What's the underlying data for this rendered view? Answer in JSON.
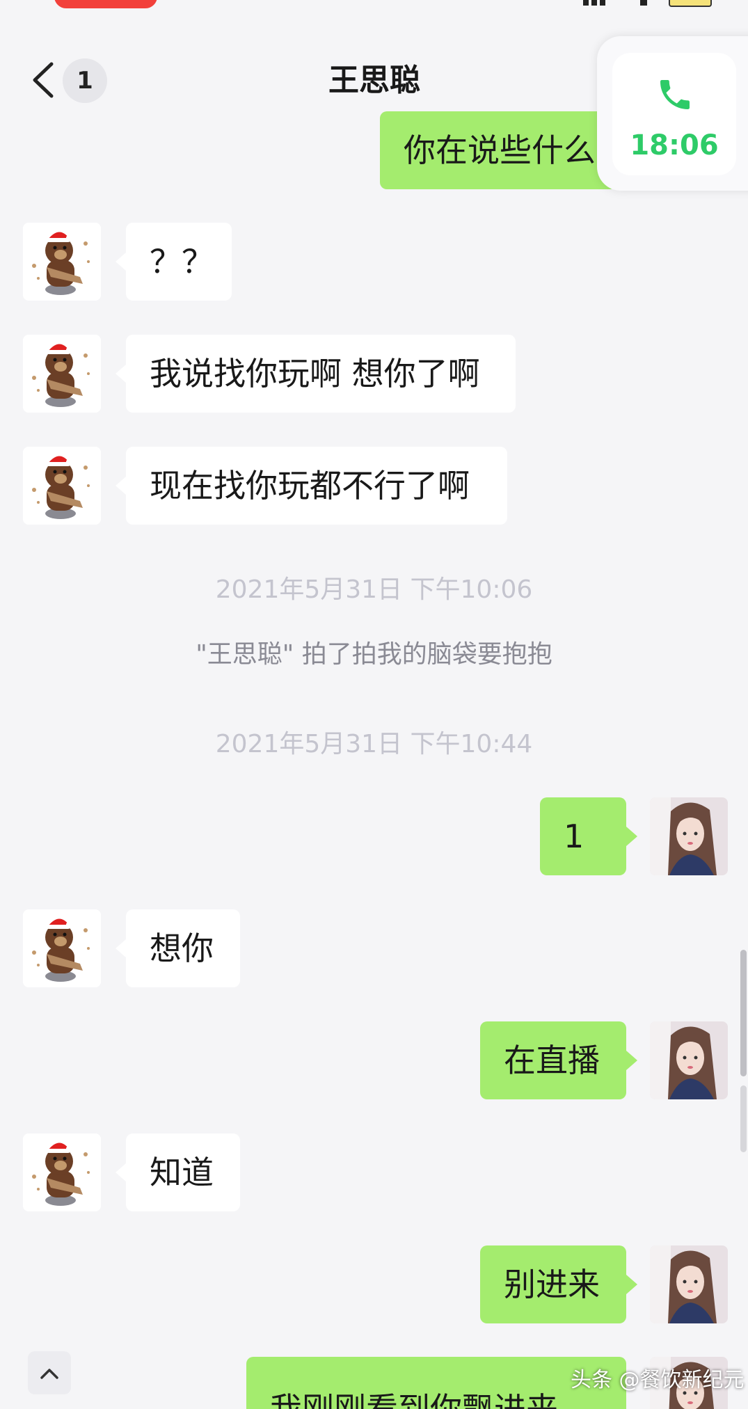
{
  "header": {
    "title": "王思聪",
    "unread_badge": "1"
  },
  "call_card": {
    "icon": "phone-icon",
    "duration": "18:06"
  },
  "messages": [
    {
      "side": "right",
      "text": "你在说些什么"
    },
    {
      "side": "left",
      "text": "？？"
    },
    {
      "side": "left",
      "text": "我说找你玩啊 想你了啊"
    },
    {
      "side": "left",
      "text": "现在找你玩都不行了啊"
    },
    {
      "side": "left",
      "text": "想你"
    },
    {
      "side": "right",
      "text": "1"
    },
    {
      "side": "right",
      "text": "在直播"
    },
    {
      "side": "left",
      "text": "知道"
    },
    {
      "side": "right",
      "text": "别进来"
    },
    {
      "side": "right",
      "text": "我刚刚看到你飘进来"
    }
  ],
  "timestamps": [
    "2021年5月31日 下午10:06",
    "2021年5月31日 下午10:44"
  ],
  "system_notice": "\"王思聪\" 拍了拍我的脑袋要抱抱",
  "watermark": "头条 @餐饮新纪元",
  "colors": {
    "sent_bubble": "#a4ec6e",
    "received_bubble": "#ffffff",
    "call_accent": "#2ecb68",
    "background": "#f5f5f7"
  }
}
